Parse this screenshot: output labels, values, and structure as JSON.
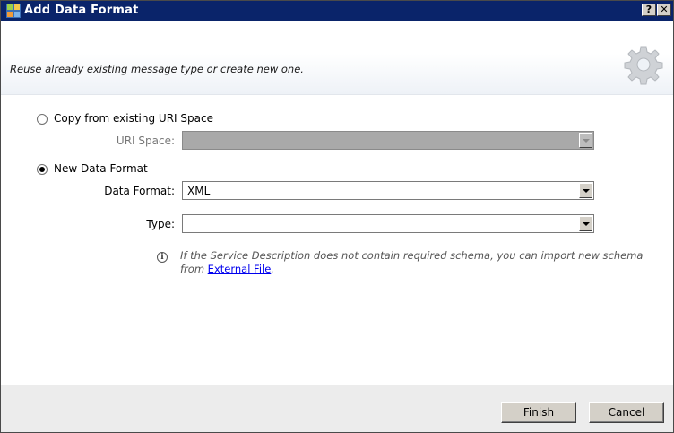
{
  "window": {
    "title": "Add Data Format",
    "help_label": "?",
    "close_label": "✕"
  },
  "header": {
    "description": "Reuse already existing message type or create new one."
  },
  "options": {
    "copy_label": "Copy from existing URI Space",
    "copy_checked": false,
    "uri_space_label": "URI Space:",
    "uri_space_value": "",
    "new_label": "New Data Format",
    "new_checked": true,
    "data_format_label": "Data Format:",
    "data_format_value": "XML",
    "type_label": "Type:",
    "type_value": ""
  },
  "info": {
    "icon_glyph": "i",
    "text": "If the Service Description does not contain required schema, you can import new schema from",
    "link_text": "External File",
    "tail": "."
  },
  "footer": {
    "finish_label": "Finish",
    "cancel_label": "Cancel"
  }
}
